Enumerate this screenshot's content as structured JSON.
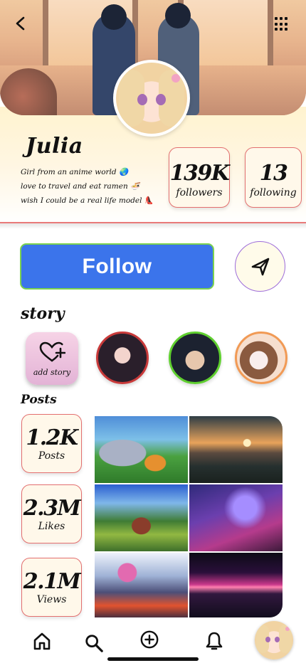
{
  "profile": {
    "name": "Julia",
    "bio": [
      "Girl from an anime world 🌏",
      "love to travel and eat ramen 🍜",
      "wish I could be a real life model 👠"
    ]
  },
  "stats": {
    "followers": {
      "value": "139K",
      "label": "followers"
    },
    "following": {
      "value": "13",
      "label": "following"
    }
  },
  "actions": {
    "follow_label": "Follow"
  },
  "story": {
    "title": "story",
    "add_label": "add story"
  },
  "posts": {
    "title": "Posts",
    "cards": [
      {
        "value": "1.2K",
        "label": "Posts"
      },
      {
        "value": "2.3M",
        "label": "Likes"
      },
      {
        "value": "2.1M",
        "label": "Views"
      }
    ]
  },
  "colors": {
    "follow_bg": "#3b74eb",
    "follow_border": "#7bd24f",
    "card_border": "#e36f6f",
    "send_border": "#9d6cd9"
  },
  "icons": [
    "back-icon",
    "grid-menu-icon",
    "send-icon",
    "heart-plus-icon",
    "home-icon",
    "search-icon",
    "add-circle-icon",
    "bell-icon"
  ]
}
